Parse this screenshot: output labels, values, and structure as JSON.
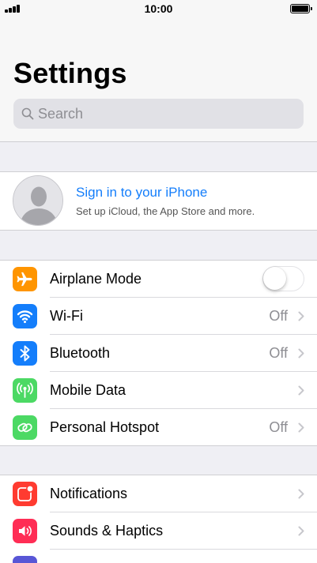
{
  "status_bar": {
    "time": "10:00"
  },
  "header": {
    "title": "Settings"
  },
  "search": {
    "placeholder": "Search"
  },
  "profile": {
    "title": "Sign in to your iPhone",
    "subtitle": "Set up iCloud, the App Store and more."
  },
  "connectivity": [
    {
      "label": "Airplane Mode",
      "icon": "airplane-icon",
      "color": "#ff9500",
      "toggle": false
    },
    {
      "label": "Wi-Fi",
      "value": "Off",
      "icon": "wifi-icon",
      "color": "#147efb"
    },
    {
      "label": "Bluetooth",
      "value": "Off",
      "icon": "bluetooth-icon",
      "color": "#147efb"
    },
    {
      "label": "Mobile Data",
      "value": "",
      "icon": "antenna-icon",
      "color": "#4cd964"
    },
    {
      "label": "Personal Hotspot",
      "value": "Off",
      "icon": "hotspot-icon",
      "color": "#4cd964"
    }
  ],
  "notifications": [
    {
      "label": "Notifications",
      "icon": "notifications-icon",
      "color": "#ff3b30"
    },
    {
      "label": "Sounds & Haptics",
      "icon": "speaker-icon",
      "color": "#ff2d55"
    }
  ],
  "colors": {
    "accent": "#147efb",
    "background": "#efeff4"
  }
}
